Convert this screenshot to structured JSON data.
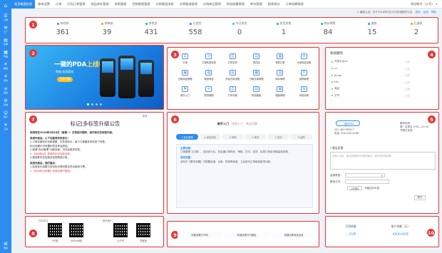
{
  "sidebar": {
    "logo": "⌂",
    "items": [
      {
        "icon": "order-icon",
        "glyph": "☰",
        "label": "订单"
      },
      {
        "icon": "factory-icon",
        "glyph": "⚒",
        "label": "工厂"
      },
      {
        "icon": "warehouse-icon",
        "glyph": "▤",
        "label": "仓库"
      },
      {
        "icon": "goods-icon",
        "glyph": "▦",
        "label": "商品"
      },
      {
        "icon": "logistics-icon",
        "glyph": "✈",
        "label": "物流"
      },
      {
        "icon": "finance-icon",
        "glyph": "¥",
        "label": "财务"
      },
      {
        "icon": "report-icon",
        "glyph": "≡",
        "label": "报表"
      },
      {
        "icon": "system-icon",
        "glyph": "⚙",
        "label": "系统"
      },
      {
        "icon": "customer-icon",
        "glyph": "☺",
        "label": "客户"
      },
      {
        "icon": "tool-icon",
        "glyph": "✦",
        "label": "工具"
      }
    ],
    "bottom": {
      "glyph": "⌘",
      "label": "更多"
    }
  },
  "topnav": {
    "tabs": [
      "首页概要信息",
      "基本设置",
      "订单",
      "打包订单管理",
      "商品库存管理",
      "采购管理",
      "货物管理管理",
      "分销渠道流程",
      "分销渠道管理",
      "分销商品管理",
      "财务结算管理",
      "库存管理",
      "报表统计",
      "订单结算管理"
    ],
    "user": "测试帐号（小号） ∨"
  },
  "subbar": {
    "notice": "⚠ 最新公告：关于2018年3月20日系统维护公告",
    "links": [
      "更多",
      "反馈",
      "帮助"
    ]
  },
  "stats": [
    {
      "label": "待付款",
      "value": "361",
      "color": "#2d8cf0"
    },
    {
      "label": "待审核",
      "value": "39",
      "color": "#ff9900"
    },
    {
      "label": "待发货",
      "value": "431",
      "color": "#19be6b"
    },
    {
      "label": "已发货",
      "value": "558",
      "color": "#2d8cf0"
    },
    {
      "label": "今日发货",
      "value": "0",
      "color": "#2db7f5"
    },
    {
      "label": "发货异常",
      "value": "1",
      "color": "#19be6b"
    },
    {
      "label": "库存预警",
      "value": "84",
      "color": "#19be6b"
    },
    {
      "label": "退款",
      "value": "15",
      "color": "#2d8cf0"
    },
    {
      "label": "已退款",
      "value": "2",
      "color": "#ff9900"
    }
  ],
  "banner": {
    "title_pre": "一键的PDA",
    "title_hl": "上线啦",
    "subtitle": "数据 极速提效",
    "button": "立即了解"
  },
  "quick": [
    {
      "label": "订单",
      "g": "☰"
    },
    {
      "label": "订单转发标签",
      "g": "⇄"
    },
    {
      "label": "打印发货",
      "g": "⎙"
    },
    {
      "label": "商在线",
      "g": "▤"
    },
    {
      "label": "采购订单",
      "g": "▦"
    },
    {
      "label": "分销商品设置",
      "g": "⚙"
    },
    {
      "label": "分销商品管理",
      "g": "▣"
    },
    {
      "label": "渠道商品",
      "g": "▧"
    },
    {
      "label": "商品仓库设置",
      "g": "▨"
    },
    {
      "label": "分销仓库管理",
      "g": "▩"
    },
    {
      "label": "库存管理",
      "g": "▥"
    },
    {
      "label": "结算管理",
      "g": "¥"
    },
    {
      "label": "新手入门",
      "g": "⚑"
    },
    {
      "label": "物流管理",
      "g": "✈"
    },
    {
      "label": "打印设置",
      "g": "⎙"
    },
    {
      "label": "物流模板",
      "g": "▤"
    },
    {
      "label": "模板管理",
      "g": "▦"
    },
    {
      "label": "系统设置",
      "g": "⚙"
    }
  ],
  "service": {
    "title": "系统服务",
    "rows": [
      {
        "name": "开放平台v2",
        "status": "✓ 正常"
      },
      {
        "name": "v1",
        "status": "✓ 正常"
      },
      {
        "name": "jd-api",
        "status": "✓ 正常"
      },
      {
        "name": "rds",
        "status": "✓ 正常"
      },
      {
        "name": "商品",
        "status": "✓ 正常"
      },
      {
        "name": "字节",
        "status": "✓ 正常"
      }
    ]
  },
  "notice": {
    "tag": "更多",
    "title": "标记|多标签升级公告",
    "lines": [
      {
        "t": "系统将在2018年3月26日（星期一）日常运行期间，进行标记多标签升级。",
        "c": "hd"
      },
      {
        "t": "系统升级后，以下功能将有所变化：",
        "c": "hd"
      },
      {
        "t": "1.订单页面标记功能调整，可多选标记，每个订单最多添加多个标签。",
        "c": ""
      },
      {
        "t": "标记设置中可设置标签名称及颜色。",
        "c": ""
      },
      {
        "t": "2.新增“标记管理”功能页面，可在此维护标签。",
        "c": ""
      },
      {
        "t": "3.【自动标记】规则同步支持多标签。",
        "c": "red"
      },
      {
        "t": "4.筛选条件支持按多标签筛选订单。",
        "c": ""
      },
      {
        "t": "系统升级后，我们建议：",
        "c": "hd"
      },
      {
        "t": "1.检查标记设置与自动标记规则是否符合使用习惯。",
        "c": ""
      },
      {
        "t": "2.【自动标记设置】完成后即可使用。",
        "c": "red"
      }
    ]
  },
  "guide": {
    "tabs": [
      "新手入门",
      "快速入门",
      "常见问题"
    ],
    "steps": [
      "1.定价审核",
      "2.添加商品",
      "3.采购",
      "4.拣货",
      "5.发货",
      "6.结算"
    ],
    "h1": "主要功能：",
    "p1": "订单管理【订单】，支持多平台、多店铺订单同步、审核、打印、发货，实现订单全流程高效处理。",
    "h2": "相关设置：",
    "p2": "请先在【基本设置】中配置店铺、仓库、物流等信息，之后即可正常使用各项功能。"
  },
  "account": {
    "logo": "一键的PDA",
    "info": [
      "QQ: 461789017",
      "电话: 400-000-4288"
    ],
    "info2": [
      "服务时间：",
      "周一至周五 9:00—21:00",
      "节假日休息"
    ],
    "section": "* 意见反馈",
    "ta_placeholder": "请输入内容，描述您遇到的问题或建议，我们将尽快处理。",
    "type_label": "选择类型：",
    "contact_label": "联系方式：",
    "upload": "上传图片",
    "upload_hint": "不超过2M/张",
    "submit": "提交"
  },
  "qr": {
    "left_caption": "扫码关注",
    "right_caption": "联系我们",
    "items": [
      "iOS版",
      "Android版",
      "公众号",
      "淘宝版"
    ]
  },
  "shortcut": {
    "buttons": [
      "快捷设置打印机",
      "快捷设置打印模板",
      "快捷设置商品信息"
    ]
  },
  "balance": {
    "left_label": "可用单量",
    "left_value": "---15单",
    "right_label": "账户余额（元）",
    "right_value": "¥200.00元"
  },
  "badge_color": "#e53935",
  "accent_color": "#2d8cf0"
}
